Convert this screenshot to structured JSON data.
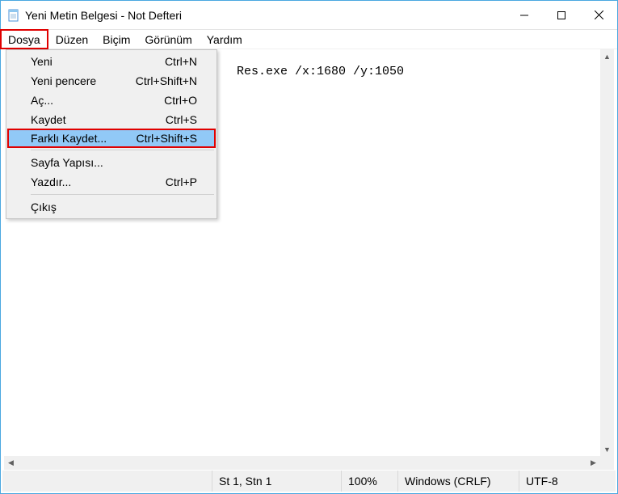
{
  "window": {
    "title": "Yeni Metin Belgesi - Not Defteri"
  },
  "menubar": {
    "items": [
      {
        "label": "Dosya",
        "active": true
      },
      {
        "label": "Düzen"
      },
      {
        "label": "Biçim"
      },
      {
        "label": "Görünüm"
      },
      {
        "label": "Yardım"
      }
    ]
  },
  "dropdown": {
    "items": [
      {
        "label": "Yeni",
        "shortcut": "Ctrl+N"
      },
      {
        "label": "Yeni pencere",
        "shortcut": "Ctrl+Shift+N"
      },
      {
        "label": "Aç...",
        "shortcut": "Ctrl+O"
      },
      {
        "label": "Kaydet",
        "shortcut": "Ctrl+S"
      },
      {
        "label": "Farklı Kaydet...",
        "shortcut": "Ctrl+Shift+S",
        "highlight": true
      },
      {
        "sep": true
      },
      {
        "label": "Sayfa Yapısı..."
      },
      {
        "label": "Yazdır...",
        "shortcut": "Ctrl+P"
      },
      {
        "sep": true
      },
      {
        "label": "Çıkış"
      }
    ]
  },
  "editor": {
    "text": "Res.exe /x:1680 /y:1050"
  },
  "statusbar": {
    "position": "St 1, Stn 1",
    "zoom": "100%",
    "lineending": "Windows (CRLF)",
    "encoding": "UTF-8"
  }
}
